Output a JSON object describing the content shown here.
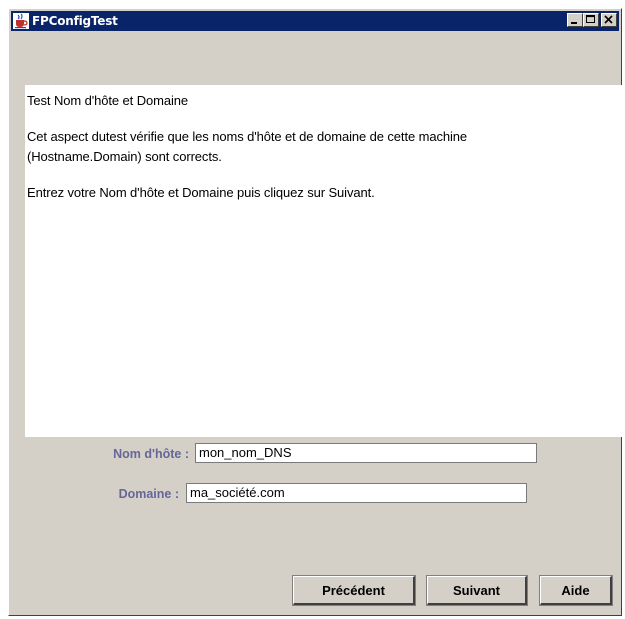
{
  "window": {
    "title": "FPConfigTest",
    "icon": "java-cup-icon",
    "controls": [
      "minimize-icon",
      "maximize-icon",
      "close-icon"
    ]
  },
  "content": {
    "heading": "Test Nom d'hôte et Domaine",
    "description_line1": "Cet aspect dutest vérifie que les noms d'hôte et de domaine de cette machine",
    "description_line2": "(Hostname.Domain) sont corrects.",
    "instruction": "Entrez votre Nom d'hôte et Domaine puis cliquez sur Suivant."
  },
  "form": {
    "hostname_label": "Nom d'hôte :",
    "hostname_value": "mon_nom_DNS",
    "domain_label": "Domaine :",
    "domain_value": "ma_société.com"
  },
  "buttons": {
    "previous": "Précédent",
    "next": "Suivant",
    "help": "Aide"
  },
  "colors": {
    "titlebar": "#0a246a",
    "window": "#d4d0c8",
    "label": "#66669a"
  }
}
